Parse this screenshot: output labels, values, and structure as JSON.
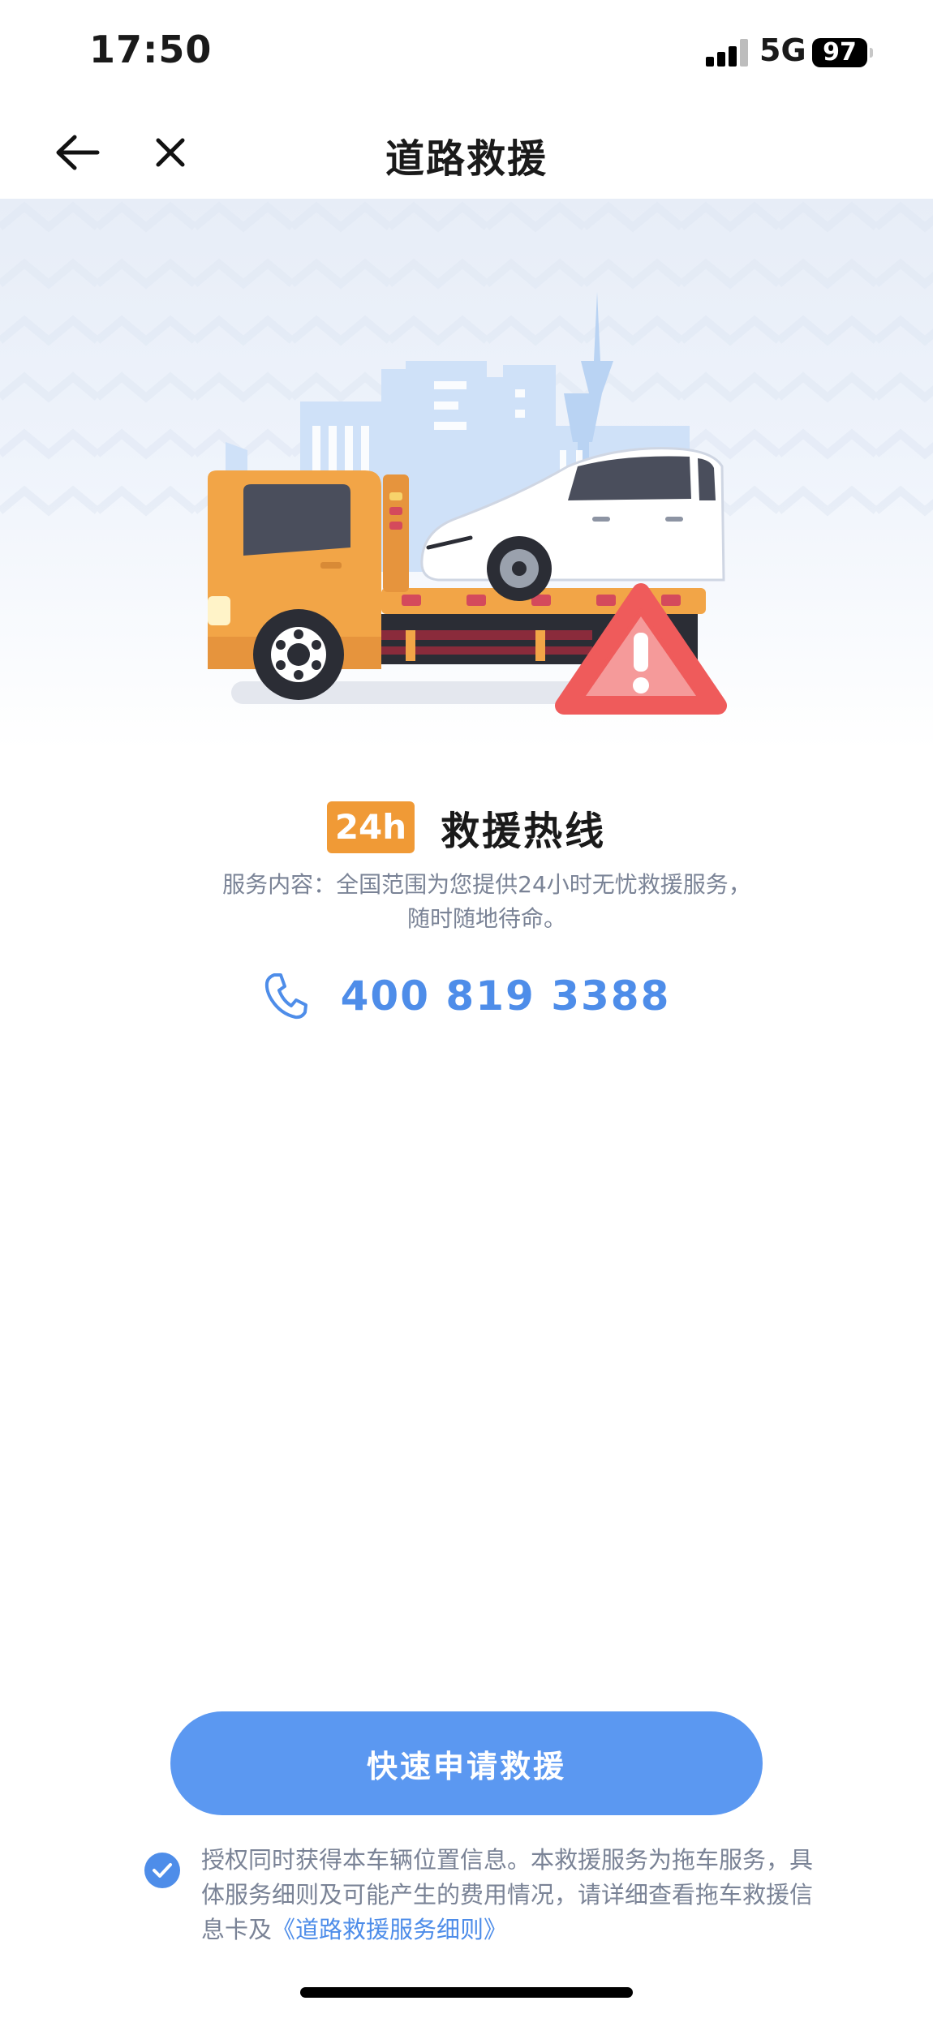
{
  "status_bar": {
    "time": "17:50",
    "network": "5G",
    "battery": "97"
  },
  "nav": {
    "title": "道路救援",
    "back_icon": "arrow-left-icon",
    "close_icon": "close-icon"
  },
  "hero": {
    "illustration": "tow-truck-with-car-and-warning-triangle"
  },
  "hotline": {
    "badge": "24h",
    "title": "救援热线",
    "description": "服务内容：全国范围为您提供24小时无忧救援服务，随时随地待命。",
    "phone_icon": "phone-icon",
    "phone_number": "400 819 3388"
  },
  "cta": {
    "label": "快速申请救援"
  },
  "agreement": {
    "checked": true,
    "text": "授权同时获得本车辆位置信息。本救援服务为拖车服务，具体服务细则及可能产生的费用情况，请详细查看拖车救援信息卡及",
    "link": "《道路救援服务细则》"
  },
  "colors": {
    "accent": "#4e8de9",
    "button": "#5b98f1",
    "badge": "#f09a36",
    "warning": "#ef5b5b"
  }
}
